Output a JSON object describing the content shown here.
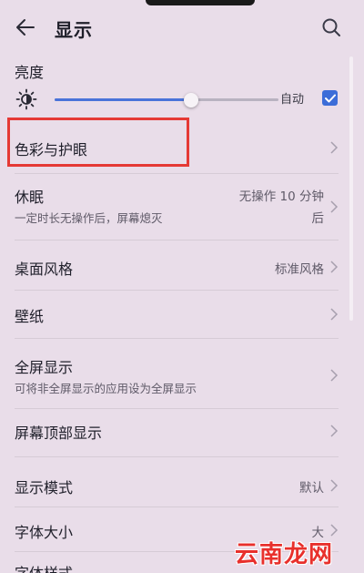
{
  "header": {
    "title": "显示",
    "back_icon": "arrow-left-icon",
    "search_icon": "search-icon"
  },
  "brightness": {
    "title": "亮度",
    "level_percent": 61,
    "auto_label": "自动",
    "auto_checked": true
  },
  "items": [
    {
      "label": "色彩与护眼"
    },
    {
      "label": "休眠",
      "sub": "一定时长无操作后，屏幕熄灭",
      "value_line1": "无操作 10 分钟",
      "value_line2": "后"
    },
    {
      "label": "桌面风格",
      "value": "标准风格"
    },
    {
      "label": "壁纸"
    },
    {
      "label": "全屏显示",
      "sub": "可将非全屏显示的应用设为全屏显示"
    },
    {
      "label": "屏幕顶部显示"
    },
    {
      "label": "显示模式",
      "value": "默认"
    },
    {
      "label": "字体大小",
      "value": "大"
    },
    {
      "label": "字体样式"
    }
  ],
  "watermark": "云南龙网",
  "colors": {
    "background": "#e9dde9",
    "accent": "#3c6dd8",
    "highlight": "#e53935"
  }
}
